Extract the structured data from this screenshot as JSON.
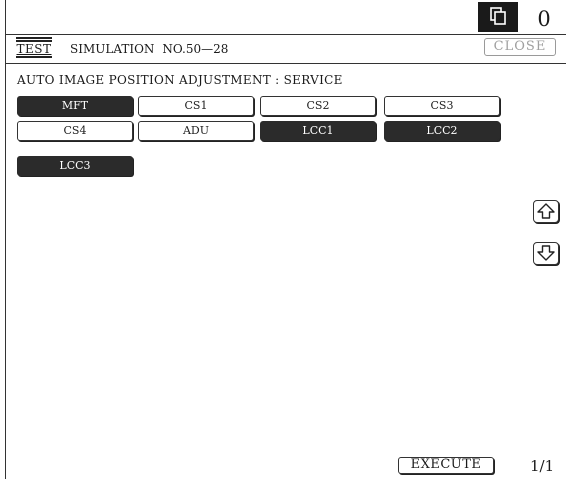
{
  "status": {
    "copy_count": "0",
    "copy_icon": "copy-icon"
  },
  "header": {
    "logo_text": "TEST",
    "simulation_label": "SIMULATION",
    "simulation_number": "NO.50—28",
    "close_label": "CLOSE"
  },
  "main": {
    "title": "AUTO  IMAGE  POSITION  ADJUSTMENT : SERVICE",
    "trays": [
      {
        "label": "MFT",
        "selected": true
      },
      {
        "label": "CS1",
        "selected": false
      },
      {
        "label": "CS2",
        "selected": false
      },
      {
        "label": "CS3",
        "selected": false
      },
      {
        "label": "CS4",
        "selected": false
      },
      {
        "label": "ADU",
        "selected": false
      },
      {
        "label": "LCC1",
        "selected": true
      },
      {
        "label": "LCC2",
        "selected": true
      },
      {
        "label": "LCC3",
        "selected": true
      }
    ]
  },
  "scroll": {
    "up_icon": "arrow-up-icon",
    "down_icon": "arrow-down-icon"
  },
  "footer": {
    "execute_label": "EXECUTE",
    "page_indicator": "1/1"
  },
  "colors": {
    "selected_bg": "#2b2b2b",
    "selected_text": "#ffffff",
    "disabled_text": "#a0a0a0"
  }
}
